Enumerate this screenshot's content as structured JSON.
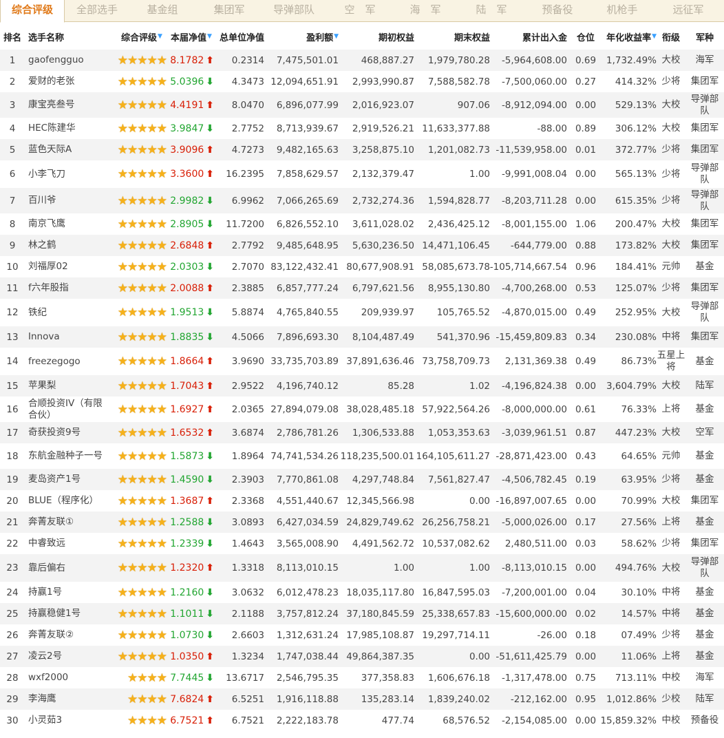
{
  "tabs": [
    "综合评级",
    "全部选手",
    "基金组",
    "集团军",
    "导弹部队",
    "空　军",
    "海　军",
    "陆　军",
    "预备役",
    "机枪手",
    "远征军"
  ],
  "active_tab": 0,
  "columns": {
    "rank": "排名",
    "name": "选手名称",
    "rating": "综合评级",
    "nav": "本届净值",
    "unit_nav": "总单位净值",
    "profit": "盈利额",
    "start_equity": "期初权益",
    "end_equity": "期末权益",
    "cash_flow": "累计出入金",
    "position": "仓位",
    "annual_return": "年化收益率",
    "grade": "衔级",
    "branch": "军种"
  },
  "sort_indicator": "▼",
  "colors": {
    "up": "#d81e06",
    "down": "#21a530",
    "star": "#f6b11a",
    "active_tab": "#e07a1a"
  },
  "rows": [
    {
      "rank": "1",
      "name": "gaofengguo",
      "stars": "★★★★★",
      "nav": "8.1782",
      "dir": "up",
      "unit_nav": "0.2314",
      "profit": "7,475,501.01",
      "start": "468,887.27",
      "end": "1,979,780.28",
      "flow": "-5,964,608.00",
      "pos": "0.69",
      "annual": "1,732.49%",
      "grade": "大校",
      "branch": "海军"
    },
    {
      "rank": "2",
      "name": "爱财的老张",
      "stars": "★★★★★",
      "nav": "5.0396",
      "dir": "down",
      "unit_nav": "4.3473",
      "profit": "12,094,651.91",
      "start": "2,993,990.87",
      "end": "7,588,582.78",
      "flow": "-7,500,060.00",
      "pos": "0.27",
      "annual": "414.32%",
      "grade": "少将",
      "branch": "集团军"
    },
    {
      "rank": "3",
      "name": "康宝亮叁号",
      "stars": "★★★★★",
      "nav": "4.4191",
      "dir": "up",
      "unit_nav": "8.0470",
      "profit": "6,896,077.99",
      "start": "2,016,923.07",
      "end": "907.06",
      "flow": "-8,912,094.00",
      "pos": "0.00",
      "annual": "529.13%",
      "grade": "大校",
      "branch": "导弹部队"
    },
    {
      "rank": "4",
      "name": "HEC陈建华",
      "stars": "★★★★★",
      "nav": "3.9847",
      "dir": "down",
      "unit_nav": "2.7752",
      "profit": "8,713,939.67",
      "start": "2,919,526.21",
      "end": "11,633,377.88",
      "flow": "-88.00",
      "pos": "0.89",
      "annual": "306.12%",
      "grade": "大校",
      "branch": "集团军"
    },
    {
      "rank": "5",
      "name": "蓝色天际A",
      "stars": "★★★★★",
      "nav": "3.9096",
      "dir": "up",
      "unit_nav": "4.7273",
      "profit": "9,482,165.63",
      "start": "3,258,875.10",
      "end": "1,201,082.73",
      "flow": "-11,539,958.00",
      "pos": "0.01",
      "annual": "372.77%",
      "grade": "少将",
      "branch": "集团军"
    },
    {
      "rank": "6",
      "name": "小李飞刀",
      "stars": "★★★★★",
      "nav": "3.3600",
      "dir": "up",
      "unit_nav": "16.2395",
      "profit": "7,858,629.57",
      "start": "2,132,379.47",
      "end": "1.00",
      "flow": "-9,991,008.04",
      "pos": "0.00",
      "annual": "565.13%",
      "grade": "少将",
      "branch": "导弹部队"
    },
    {
      "rank": "7",
      "name": "百川爷",
      "stars": "★★★★★",
      "nav": "2.9982",
      "dir": "down",
      "unit_nav": "6.9962",
      "profit": "7,066,265.69",
      "start": "2,732,274.36",
      "end": "1,594,828.77",
      "flow": "-8,203,711.28",
      "pos": "0.00",
      "annual": "615.35%",
      "grade": "少将",
      "branch": "导弹部队"
    },
    {
      "rank": "8",
      "name": "南京飞鹰",
      "stars": "★★★★★",
      "nav": "2.8905",
      "dir": "down",
      "unit_nav": "11.7200",
      "profit": "6,826,552.10",
      "start": "3,611,028.02",
      "end": "2,436,425.12",
      "flow": "-8,001,155.00",
      "pos": "1.06",
      "annual": "200.47%",
      "grade": "大校",
      "branch": "集团军"
    },
    {
      "rank": "9",
      "name": "林之鹤",
      "stars": "★★★★★",
      "nav": "2.6848",
      "dir": "up",
      "unit_nav": "2.7792",
      "profit": "9,485,648.95",
      "start": "5,630,236.50",
      "end": "14,471,106.45",
      "flow": "-644,779.00",
      "pos": "0.88",
      "annual": "173.82%",
      "grade": "大校",
      "branch": "集团军"
    },
    {
      "rank": "10",
      "name": "刘福厚02",
      "stars": "★★★★★",
      "nav": "2.0303",
      "dir": "down",
      "unit_nav": "2.7070",
      "profit": "83,122,432.41",
      "start": "80,677,908.91",
      "end": "58,085,673.78",
      "flow": "-105,714,667.54",
      "pos": "0.96",
      "annual": "184.41%",
      "grade": "元帅",
      "branch": "基金"
    },
    {
      "rank": "11",
      "name": "f六年股指",
      "stars": "★★★★★",
      "nav": "2.0088",
      "dir": "up",
      "unit_nav": "2.3885",
      "profit": "6,857,777.24",
      "start": "6,797,621.56",
      "end": "8,955,130.80",
      "flow": "-4,700,268.00",
      "pos": "0.53",
      "annual": "125.07%",
      "grade": "少将",
      "branch": "集团军"
    },
    {
      "rank": "12",
      "name": "铁纪",
      "stars": "★★★★★",
      "nav": "1.9513",
      "dir": "down",
      "unit_nav": "5.8874",
      "profit": "4,765,840.55",
      "start": "209,939.97",
      "end": "105,765.52",
      "flow": "-4,870,015.00",
      "pos": "0.49",
      "annual": "252.95%",
      "grade": "大校",
      "branch": "导弹部队"
    },
    {
      "rank": "13",
      "name": "Innova",
      "stars": "★★★★★",
      "nav": "1.8835",
      "dir": "down",
      "unit_nav": "4.5066",
      "profit": "7,896,693.30",
      "start": "8,104,487.49",
      "end": "541,370.96",
      "flow": "-15,459,809.83",
      "pos": "0.34",
      "annual": "230.08%",
      "grade": "中将",
      "branch": "集团军"
    },
    {
      "rank": "14",
      "name": "freezegogo",
      "stars": "★★★★★",
      "nav": "1.8664",
      "dir": "up",
      "unit_nav": "3.9690",
      "profit": "33,735,703.89",
      "start": "37,891,636.46",
      "end": "73,758,709.73",
      "flow": "2,131,369.38",
      "pos": "0.49",
      "annual": "86.73%",
      "grade": "五星上将",
      "branch": "基金"
    },
    {
      "rank": "15",
      "name": "苹果梨",
      "stars": "★★★★★",
      "nav": "1.7043",
      "dir": "up",
      "unit_nav": "2.9522",
      "profit": "4,196,740.12",
      "start": "85.28",
      "end": "1.02",
      "flow": "-4,196,824.38",
      "pos": "0.00",
      "annual": "3,604.79%",
      "grade": "大校",
      "branch": "陆军"
    },
    {
      "rank": "16",
      "name": "合顺投资IV（有限合伙）",
      "stars": "★★★★★",
      "nav": "1.6927",
      "dir": "up",
      "unit_nav": "2.0365",
      "profit": "27,894,079.08",
      "start": "38,028,485.18",
      "end": "57,922,564.26",
      "flow": "-8,000,000.00",
      "pos": "0.61",
      "annual": "76.33%",
      "grade": "上将",
      "branch": "基金"
    },
    {
      "rank": "17",
      "name": "奇获投资9号",
      "stars": "★★★★★",
      "nav": "1.6532",
      "dir": "up",
      "unit_nav": "3.6874",
      "profit": "2,786,781.26",
      "start": "1,306,533.88",
      "end": "1,053,353.63",
      "flow": "-3,039,961.51",
      "pos": "0.87",
      "annual": "447.23%",
      "grade": "大校",
      "branch": "空军"
    },
    {
      "rank": "18",
      "name": "东航金融种子一号",
      "stars": "★★★★★",
      "nav": "1.5873",
      "dir": "down",
      "unit_nav": "1.8964",
      "profit": "74,741,534.26",
      "start": "118,235,500.01",
      "end": "164,105,611.27",
      "flow": "-28,871,423.00",
      "pos": "0.43",
      "annual": "64.65%",
      "grade": "元帅",
      "branch": "基金"
    },
    {
      "rank": "19",
      "name": "麦岛资产1号",
      "stars": "★★★★★",
      "nav": "1.4590",
      "dir": "down",
      "unit_nav": "2.3903",
      "profit": "7,770,861.08",
      "start": "4,297,748.84",
      "end": "7,561,827.47",
      "flow": "-4,506,782.45",
      "pos": "0.19",
      "annual": "63.95%",
      "grade": "少将",
      "branch": "基金"
    },
    {
      "rank": "20",
      "name": "BLUE（程序化）",
      "stars": "★★★★★",
      "nav": "1.3687",
      "dir": "up",
      "unit_nav": "2.3368",
      "profit": "4,551,440.67",
      "start": "12,345,566.98",
      "end": "0.00",
      "flow": "-16,897,007.65",
      "pos": "0.00",
      "annual": "70.99%",
      "grade": "大校",
      "branch": "集团军"
    },
    {
      "rank": "21",
      "name": "奔菁友联①",
      "stars": "★★★★★",
      "nav": "1.2588",
      "dir": "down",
      "unit_nav": "3.0893",
      "profit": "6,427,034.59",
      "start": "24,829,749.62",
      "end": "26,256,758.21",
      "flow": "-5,000,026.00",
      "pos": "0.17",
      "annual": "27.56%",
      "grade": "上将",
      "branch": "基金"
    },
    {
      "rank": "22",
      "name": "中睿致远",
      "stars": "★★★★★",
      "nav": "1.2339",
      "dir": "down",
      "unit_nav": "1.4643",
      "profit": "3,565,008.90",
      "start": "4,491,562.72",
      "end": "10,537,082.62",
      "flow": "2,480,511.00",
      "pos": "0.03",
      "annual": "58.62%",
      "grade": "少将",
      "branch": "集团军"
    },
    {
      "rank": "23",
      "name": "靠后偏右",
      "stars": "★★★★★",
      "nav": "1.2320",
      "dir": "up",
      "unit_nav": "1.3318",
      "profit": "8,113,010.15",
      "start": "1.00",
      "end": "1.00",
      "flow": "-8,113,010.15",
      "pos": "0.00",
      "annual": "494.76%",
      "grade": "大校",
      "branch": "导弹部队"
    },
    {
      "rank": "24",
      "name": "持赢1号",
      "stars": "★★★★★",
      "nav": "1.2160",
      "dir": "down",
      "unit_nav": "3.0632",
      "profit": "6,012,478.23",
      "start": "18,035,117.80",
      "end": "16,847,595.03",
      "flow": "-7,200,001.00",
      "pos": "0.04",
      "annual": "30.10%",
      "grade": "中将",
      "branch": "基金"
    },
    {
      "rank": "25",
      "name": "持赢稳健1号",
      "stars": "★★★★★",
      "nav": "1.1011",
      "dir": "down",
      "unit_nav": "2.1188",
      "profit": "3,757,812.24",
      "start": "37,180,845.59",
      "end": "25,338,657.83",
      "flow": "-15,600,000.00",
      "pos": "0.02",
      "annual": "14.57%",
      "grade": "中将",
      "branch": "基金"
    },
    {
      "rank": "26",
      "name": "奔菁友联②",
      "stars": "★★★★★",
      "nav": "1.0730",
      "dir": "down",
      "unit_nav": "2.6603",
      "profit": "1,312,631.24",
      "start": "17,985,108.87",
      "end": "19,297,714.11",
      "flow": "-26.00",
      "pos": "0.18",
      "annual": "07.49%",
      "grade": "少将",
      "branch": "基金"
    },
    {
      "rank": "27",
      "name": "凌云2号",
      "stars": "★★★★★",
      "nav": "1.0350",
      "dir": "up",
      "unit_nav": "1.3234",
      "profit": "1,747,038.44",
      "start": "49,864,387.35",
      "end": "0.00",
      "flow": "-51,611,425.79",
      "pos": "0.00",
      "annual": "11.06%",
      "grade": "上将",
      "branch": "基金"
    },
    {
      "rank": "28",
      "name": "wxf2000",
      "stars": "★★★★",
      "nav": "7.7445",
      "dir": "down",
      "unit_nav": "13.6717",
      "profit": "2,546,795.35",
      "start": "377,358.83",
      "end": "1,606,676.18",
      "flow": "-1,317,478.00",
      "pos": "0.75",
      "annual": "713.11%",
      "grade": "中校",
      "branch": "海军"
    },
    {
      "rank": "29",
      "name": "李海鹰",
      "stars": "★★★★",
      "nav": "7.6824",
      "dir": "up",
      "unit_nav": "6.5251",
      "profit": "1,916,118.88",
      "start": "135,283.14",
      "end": "1,839,240.02",
      "flow": "-212,162.00",
      "pos": "0.95",
      "annual": "1,012.86%",
      "grade": "少校",
      "branch": "陆军"
    },
    {
      "rank": "30",
      "name": "小灵茹3",
      "stars": "★★★★",
      "nav": "6.7521",
      "dir": "up",
      "unit_nav": "6.7521",
      "profit": "2,222,183.78",
      "start": "477.74",
      "end": "68,576.52",
      "flow": "-2,154,085.00",
      "pos": "0.00",
      "annual": "15,859.32%",
      "grade": "中校",
      "branch": "预备役"
    }
  ]
}
